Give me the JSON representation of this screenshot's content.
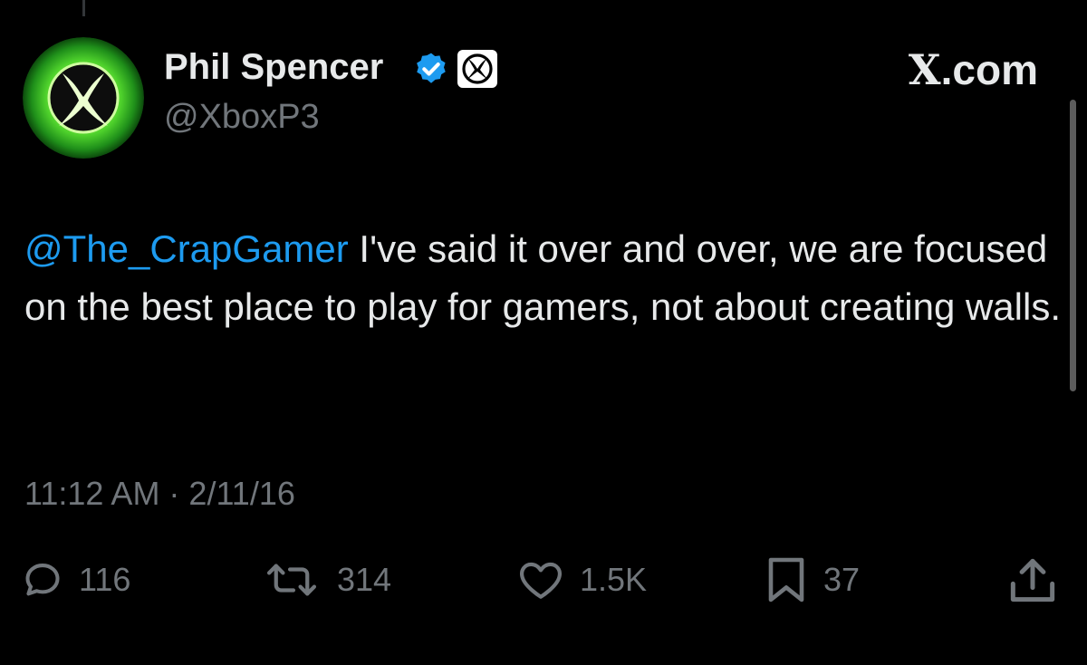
{
  "author": {
    "display_name": "Phil Spencer",
    "handle": "@XboxP3",
    "avatar_icon": "xbox-logo-icon",
    "verified_icon": "verified-badge-icon",
    "affiliate_icon": "xbox-affiliate-badge-icon"
  },
  "site": {
    "label_letter": "X",
    "label_rest": ".com"
  },
  "tweet": {
    "mention": "@The_CrapGamer",
    "body": " I've said it over and over, we are focused on the best place to play for gamers, not about creating walls.",
    "timestamp": "11:12 AM · 2/11/16"
  },
  "actions": {
    "replies": "116",
    "retweets": "314",
    "likes": "1.5K",
    "bookmarks": "37"
  },
  "colors": {
    "background": "#000000",
    "text": "#e7e9ea",
    "secondary_text": "#71767b",
    "link": "#1d9bf0",
    "verified": "#1d9bf0",
    "xbox_green": "#3cc42a"
  }
}
